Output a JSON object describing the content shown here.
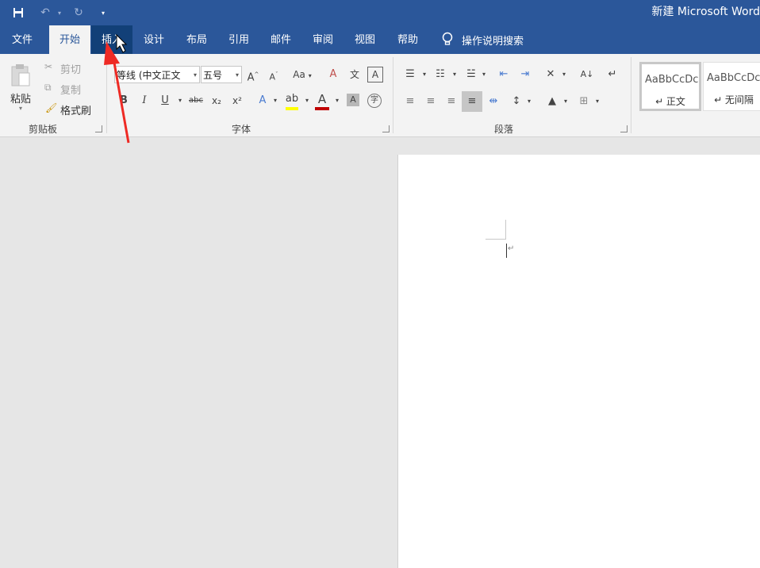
{
  "titlebar": {
    "title": "新建 Microsoft Word",
    "qat": {
      "save_icon": "save-icon",
      "undo_icon": "undo-icon",
      "redo_icon": "redo-icon",
      "customize_icon": "customize-qat-icon"
    }
  },
  "tabs": [
    "文件",
    "开始",
    "插入",
    "设计",
    "布局",
    "引用",
    "邮件",
    "审阅",
    "视图",
    "帮助"
  ],
  "tellme": "操作说明搜索",
  "clipboard": {
    "paste": "粘贴",
    "cut": "剪切",
    "copy": "复制",
    "format_painter": "格式刷",
    "label": "剪贴板"
  },
  "font": {
    "font_name": "等线 (中文正文",
    "font_size": "五号",
    "case": "Aa",
    "bold": "B",
    "italic": "I",
    "underline": "U",
    "strike": "abc",
    "subscript": "x₂",
    "superscript": "x²",
    "label": "字体"
  },
  "paragraph": {
    "label": "段落"
  },
  "styles": [
    {
      "sample": "AaBbCcDc",
      "name": "↵ 正文"
    },
    {
      "sample": "AaBbCcDc",
      "name": "↵ 无间隔"
    }
  ],
  "colors": {
    "brand": "#2b579a",
    "highlight": "#ffff00",
    "font_color": "#c00000"
  }
}
